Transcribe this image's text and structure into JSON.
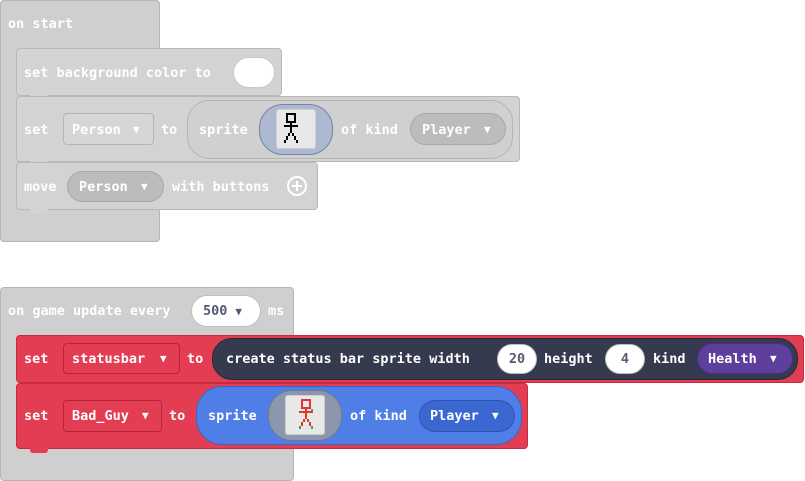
{
  "on_start": {
    "label": "on start",
    "set_bg": {
      "label": "set background color to"
    },
    "set_sprite": {
      "set": "set",
      "variable": "Person",
      "to": "to",
      "sprite": "sprite",
      "of_kind": "of kind",
      "kind": "Player"
    },
    "move": {
      "label": "move",
      "variable": "Person",
      "with_buttons": "with buttons",
      "icon": "plus-circle-icon"
    }
  },
  "on_update": {
    "label_prefix": "on game update every",
    "interval": "500",
    "label_suffix": "ms",
    "set_statusbar": {
      "set": "set",
      "variable": "statusbar",
      "to": "to",
      "create": "create status bar sprite width",
      "width": "20",
      "height_label": "height",
      "height": "4",
      "kind_label": "kind",
      "kind": "Health"
    },
    "set_badguy": {
      "set": "set",
      "variable": "Bad_Guy",
      "to": "to",
      "sprite": "sprite",
      "of_kind": "of kind",
      "kind": "Player"
    }
  },
  "colors": {
    "disabled_grey": "#cfcfcf",
    "set_red": "#e33d54",
    "status_dark": "#363a4f",
    "sprite_blue": "#4f7fe6",
    "health_purple": "#5e3f9c"
  },
  "icons": {
    "dropdown": "chevron-down-icon",
    "player_sprite": "black-stick-figure-icon",
    "enemy_sprite": "red-stick-figure-icon"
  }
}
